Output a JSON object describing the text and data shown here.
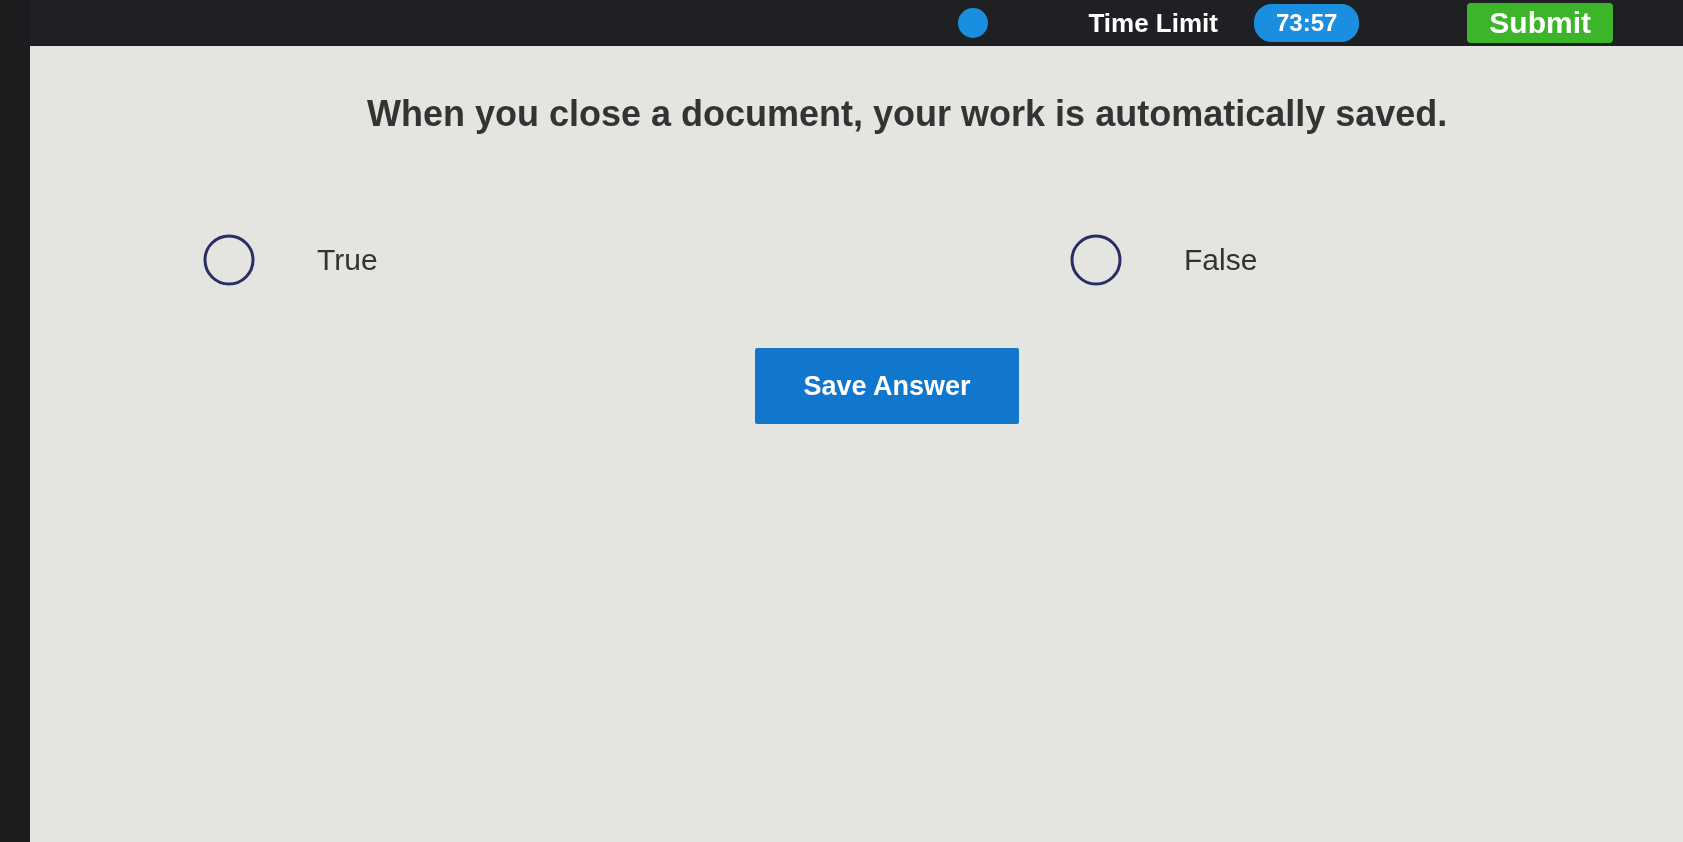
{
  "top_bar": {
    "time_limit_label": "Time Limit",
    "timer": "73:57",
    "submit_button": "Submit"
  },
  "question": {
    "text": "When you close a document, your work is automatically saved.",
    "options": [
      {
        "label": "True",
        "selected": false
      },
      {
        "label": "False",
        "selected": false
      }
    ]
  },
  "save_button": "Save Answer"
}
